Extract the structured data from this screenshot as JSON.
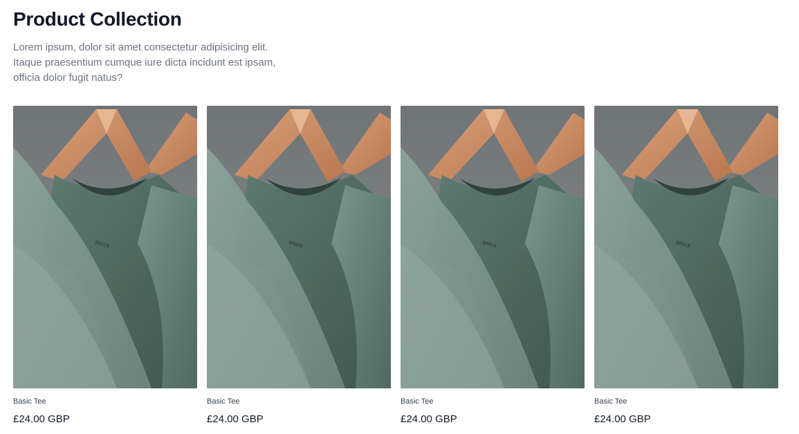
{
  "header": {
    "title": "Product Collection",
    "description": "Lorem ipsum, dolor sit amet consectetur adipisicing elit. Itaque praesentium cumque iure dicta incidunt est ipsam, officia dolor fugit natus?"
  },
  "products": [
    {
      "name": "Basic Tee",
      "price": "£24.00 GBP"
    },
    {
      "name": "Basic Tee",
      "price": "£24.00 GBP"
    },
    {
      "name": "Basic Tee",
      "price": "£24.00 GBP"
    },
    {
      "name": "Basic Tee",
      "price": "£24.00 GBP"
    }
  ],
  "colors": {
    "title": "#111827",
    "description": "#6b7280",
    "shirt": "#6f8a80",
    "hanger": "#c98b66",
    "backdrop": "#7a7e80"
  }
}
